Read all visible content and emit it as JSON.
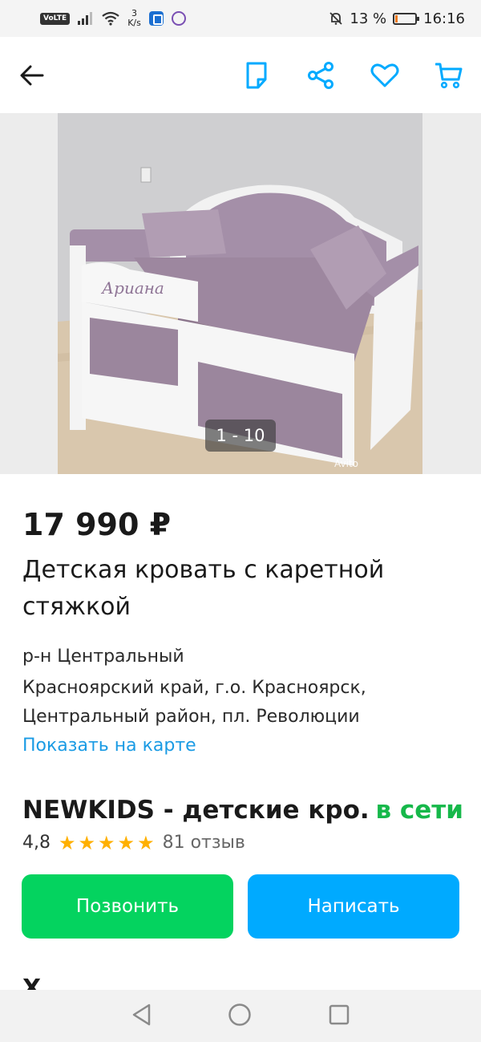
{
  "status_bar": {
    "volte": "VoLTE",
    "speed_value": "3",
    "speed_unit": "K/s",
    "battery_percent": "13 %",
    "battery_level": 0.13,
    "time": "16:16"
  },
  "gallery": {
    "counter": "1 - 10",
    "watermark": "Avito",
    "headboard_text": "Ариана"
  },
  "listing": {
    "price": "17 990 ₽",
    "title": "Детская кровать с каретной стяжкой",
    "district": "р-н Центральный",
    "address_line1": "Красноярский край, г.о. Красноярск,",
    "address_line2": "Центральный район, пл. Революции",
    "map_link": "Показать на карте"
  },
  "seller": {
    "name": "NEWKIDS - детские кро...",
    "status": "в сети",
    "rating": "4,8",
    "stars": 5,
    "reviews": "81 отзыв"
  },
  "actions": {
    "call_label": "Позвонить",
    "write_label": "Написать"
  },
  "next_section_peek": "Х",
  "colors": {
    "accent_blue": "#00aaff",
    "call_green": "#04d35f",
    "online_green": "#16b84a",
    "star_orange": "#ffb000",
    "link_blue": "#1a9be4"
  },
  "icons": [
    "back-arrow-icon",
    "note-icon",
    "share-icon",
    "heart-icon",
    "cart-icon",
    "nav-back-icon",
    "nav-home-icon",
    "nav-recents-icon"
  ]
}
